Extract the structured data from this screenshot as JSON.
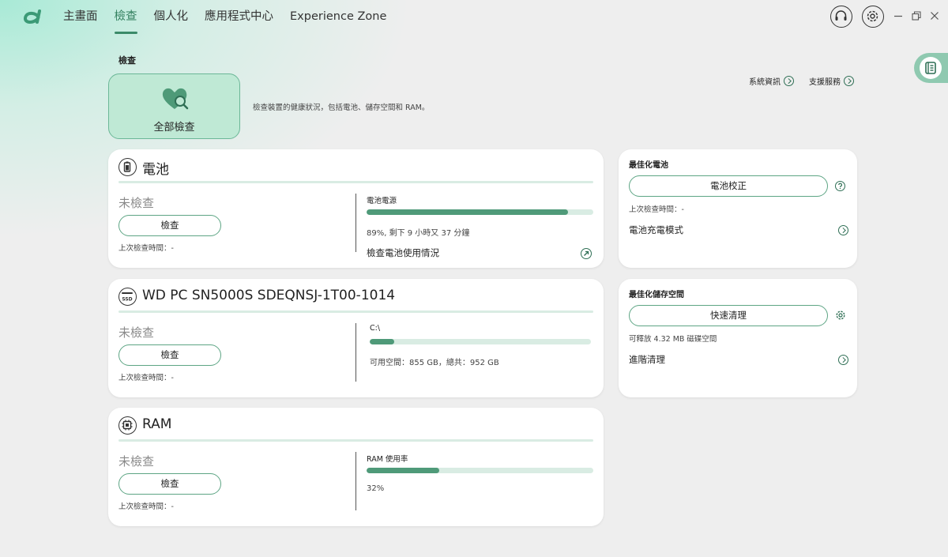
{
  "nav": {
    "items": [
      {
        "label": "主畫面",
        "active": false
      },
      {
        "label": "檢查",
        "active": true
      },
      {
        "label": "個人化",
        "active": false
      },
      {
        "label": "應用程式中心",
        "active": false
      },
      {
        "label": "Experience Zone",
        "active": false
      }
    ]
  },
  "icons": {
    "logo": "acer-logo-icon",
    "support": "headset-icon",
    "settings": "gear-icon",
    "minimize": "minimize-icon",
    "restore": "restore-icon",
    "close": "close-icon"
  },
  "page": {
    "title": "檢查",
    "full_check_label": "全部檢查",
    "description": "檢查裝置的健康狀況，包括電池、儲存空間和 RAM。",
    "links": {
      "system_info": "系統資訊",
      "support": "支援服務"
    }
  },
  "battery": {
    "title": "電池",
    "status": "未檢查",
    "check_label": "檢查",
    "last_check": "上次檢查時間：-",
    "metric_label": "電池電源",
    "level_percent": 89,
    "metric_sub": "89%, 剩下 9 小時又 37 分鐘",
    "usage_link": "檢查電池使用情況"
  },
  "storage": {
    "title": "WD PC SN5000S SDEQNSJ-1T00-1014",
    "icon_text": "SSD",
    "status": "未檢查",
    "check_label": "檢查",
    "last_check": "上次檢查時間：-",
    "drive_label": "C:\\",
    "used_percent": 11,
    "metric_sub": "可用空間：855 GB，總共：952 GB"
  },
  "ram": {
    "title": "RAM",
    "status": "未檢查",
    "check_label": "檢查",
    "last_check": "上次檢查時間：-",
    "metric_label": "RAM 使用率",
    "usage_percent": 32,
    "metric_sub": "32%"
  },
  "optimize_battery": {
    "title": "最佳化電池",
    "button_label": "電池校正",
    "last_check": "上次檢查時間：-",
    "link": "電池充電模式"
  },
  "optimize_storage": {
    "title": "最佳化儲存空間",
    "button_label": "快速清理",
    "sub": "可釋放 4.32 MB 磁碟空間",
    "link": "進階清理"
  },
  "colors": {
    "accent": "#3b8a69",
    "bar_fill": "#4f9a79",
    "bar_track": "#d9ece3",
    "tile_bg": "#bfe9d5"
  }
}
